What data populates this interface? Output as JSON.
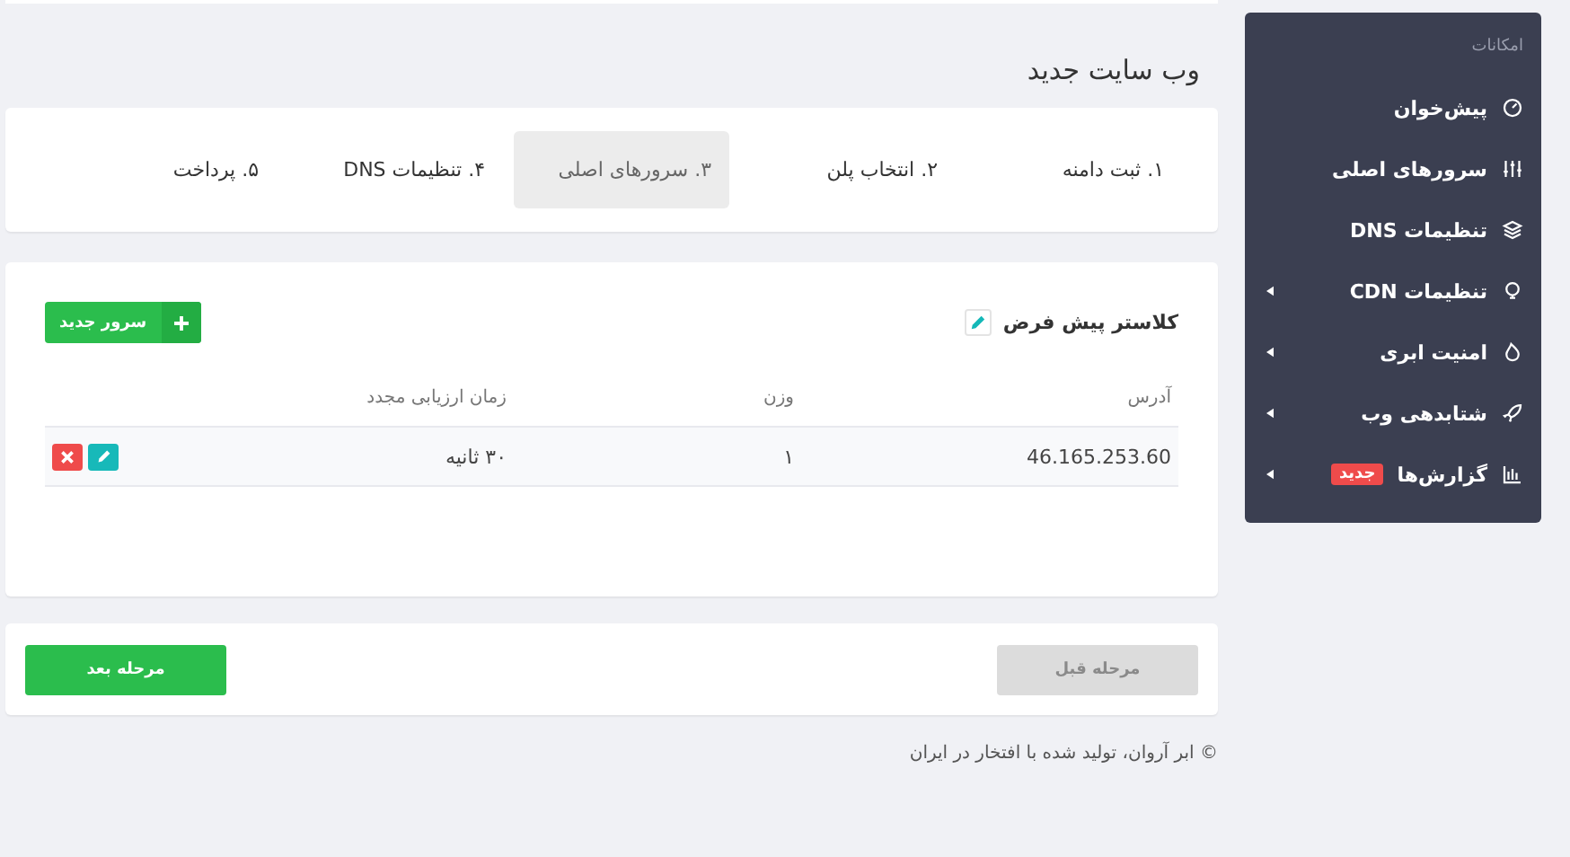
{
  "page_title": "وب سایت جدید",
  "steps": [
    {
      "label": "۱. ثبت دامنه",
      "selected": false
    },
    {
      "label": "۲. انتخاب پلن",
      "selected": false
    },
    {
      "label": "۳. سرورهای اصلی",
      "selected": true
    },
    {
      "label": "۴. تنظیمات DNS",
      "selected": false
    },
    {
      "label": "۵. پرداخت",
      "selected": false
    }
  ],
  "cluster": {
    "title": "کلاستر پیش فرض",
    "add_button": "سرور جدید"
  },
  "table": {
    "columns": [
      "آدرس",
      "وزن",
      "زمان ارزیابی مجدد"
    ],
    "rows": [
      {
        "address": "46.165.253.60",
        "weight": "۱",
        "recheck": "۳۰ ثانیه"
      }
    ]
  },
  "nav": {
    "previous": {
      "label": "مرحله قبل",
      "disabled": true
    },
    "next": {
      "label": "مرحله بعد",
      "disabled": false
    }
  },
  "footer": "© ابر آروان، تولید شده با افتخار در ایران",
  "sidebar": {
    "heading": "امکانات",
    "items": [
      {
        "label": "پیش‌خوان",
        "submenu": false
      },
      {
        "label": "سرورهای اصلی",
        "submenu": false
      },
      {
        "label": "تنظیمات DNS",
        "submenu": false
      },
      {
        "label": "تنظیمات CDN",
        "submenu": true
      },
      {
        "label": "امنیت ابری",
        "submenu": true
      },
      {
        "label": "شتابدهی وب",
        "submenu": true
      },
      {
        "label": "گزارش‌ها",
        "submenu": true,
        "badge": "جدید"
      }
    ]
  }
}
